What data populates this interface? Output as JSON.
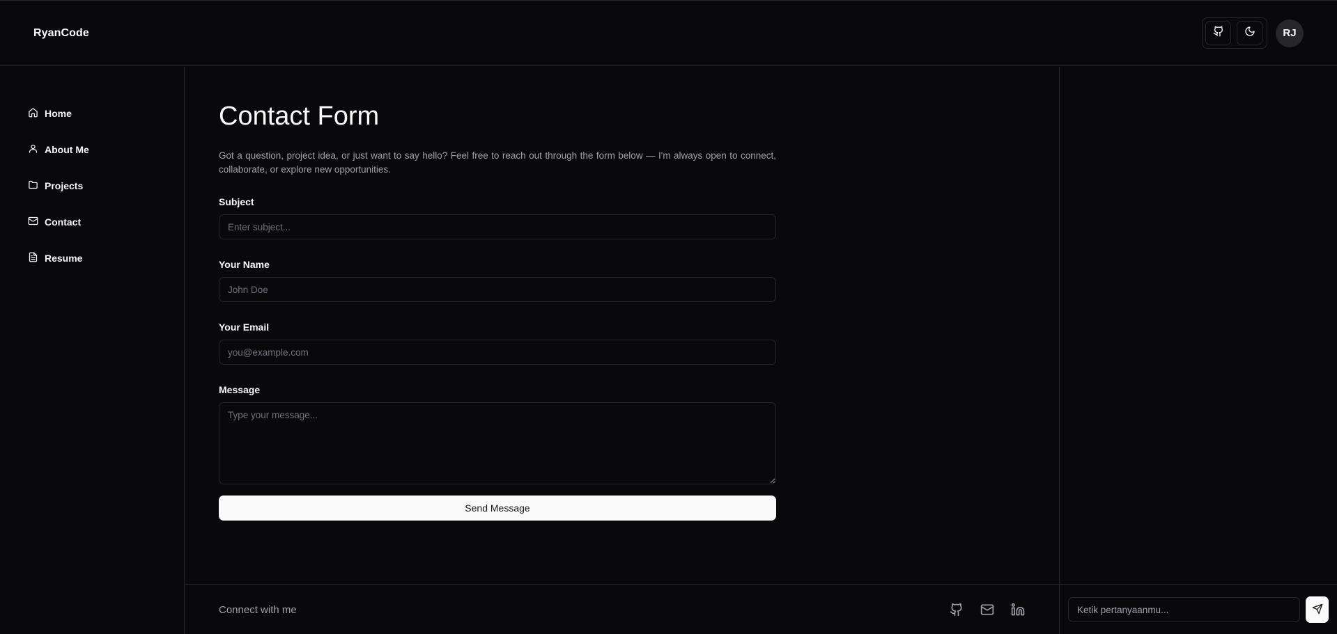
{
  "header": {
    "brand": "RyanCode",
    "avatar_initials": "RJ",
    "icons": [
      "github-icon",
      "moon-icon"
    ]
  },
  "sidebar": {
    "items": [
      {
        "label": "Home",
        "icon": "home-icon"
      },
      {
        "label": "About Me",
        "icon": "user-icon"
      },
      {
        "label": "Projects",
        "icon": "folder-icon"
      },
      {
        "label": "Contact",
        "icon": "mail-icon"
      },
      {
        "label": "Resume",
        "icon": "file-text-icon"
      }
    ]
  },
  "main": {
    "title": "Contact Form",
    "intro": "Got a question, project idea, or just want to say hello? Feel free to reach out through the form below — I'm always open to connect, collaborate, or explore new opportunities.",
    "fields": {
      "subject": {
        "label": "Subject",
        "placeholder": "Enter subject...",
        "value": ""
      },
      "name": {
        "label": "Your Name",
        "placeholder": "John Doe",
        "value": ""
      },
      "email": {
        "label": "Your Email",
        "placeholder": "you@example.com",
        "value": ""
      },
      "message": {
        "label": "Message",
        "placeholder": "Type your message...",
        "value": ""
      }
    },
    "submit_label": "Send Message"
  },
  "footer": {
    "text": "Connect with me",
    "icons": [
      "github-icon",
      "mail-icon",
      "linkedin-icon"
    ]
  },
  "chat": {
    "placeholder": "Ketik pertanyaanmu...",
    "send_icon": "send-icon"
  },
  "colors": {
    "background": "#09090b",
    "border": "#27272a",
    "text": "#fafafa",
    "muted": "#a1a1aa",
    "button_bg": "#fafafa"
  }
}
